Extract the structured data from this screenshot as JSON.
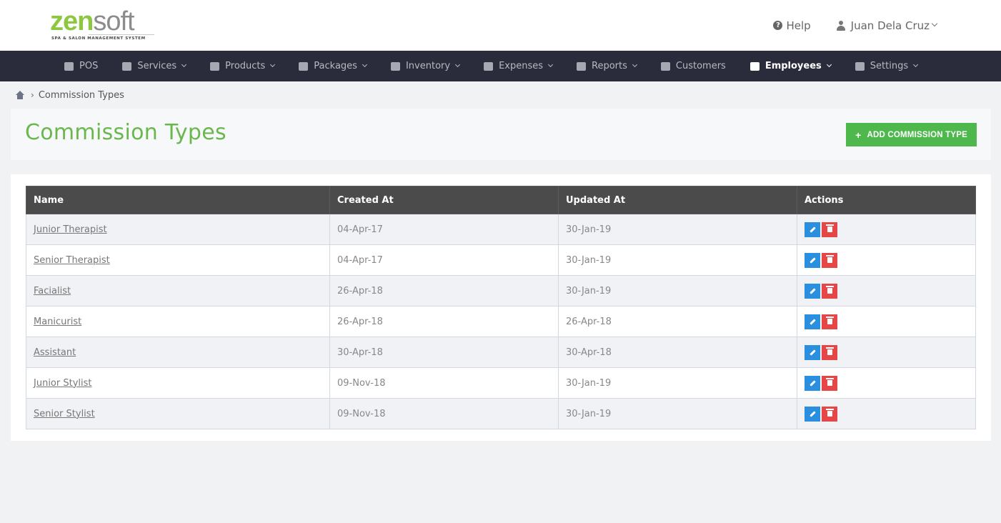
{
  "brand": {
    "zen": "zen",
    "soft": "soft",
    "tagline": "SPA & SALON MANAGEMENT SYSTEM"
  },
  "header": {
    "help_label": "Help",
    "user_name": "Juan Dela Cruz"
  },
  "nav": {
    "items": [
      {
        "label": "POS",
        "icon": "calculator-icon",
        "has_caret": false
      },
      {
        "label": "Services",
        "icon": "hand-icon",
        "has_caret": true
      },
      {
        "label": "Products",
        "icon": "cart-icon",
        "has_caret": true
      },
      {
        "label": "Packages",
        "icon": "tags-icon",
        "has_caret": true
      },
      {
        "label": "Inventory",
        "icon": "list-icon",
        "has_caret": true
      },
      {
        "label": "Expenses",
        "icon": "image-icon",
        "has_caret": true
      },
      {
        "label": "Reports",
        "icon": "bar-chart-icon",
        "has_caret": true
      },
      {
        "label": "Customers",
        "icon": "users-icon",
        "has_caret": false
      },
      {
        "label": "Employees",
        "icon": "briefcase-icon",
        "has_caret": true,
        "active": true
      },
      {
        "label": "Settings",
        "icon": "gear-icon",
        "has_caret": true
      }
    ]
  },
  "breadcrumb": {
    "current": "Commission Types"
  },
  "page": {
    "title": "Commission Types",
    "add_button": "ADD COMMISSION TYPE"
  },
  "table": {
    "columns": [
      "Name",
      "Created At",
      "Updated At",
      "Actions"
    ],
    "rows": [
      {
        "name": "Junior Therapist",
        "created": "04-Apr-17",
        "updated": "30-Jan-19"
      },
      {
        "name": "Senior Therapist",
        "created": "04-Apr-17",
        "updated": "30-Jan-19"
      },
      {
        "name": "Facialist",
        "created": "26-Apr-18",
        "updated": "30-Jan-19"
      },
      {
        "name": "Manicurist",
        "created": "26-Apr-18",
        "updated": "26-Apr-18"
      },
      {
        "name": "Assistant",
        "created": "30-Apr-18",
        "updated": "30-Apr-18"
      },
      {
        "name": "Junior Stylist",
        "created": "09-Nov-18",
        "updated": "30-Jan-19"
      },
      {
        "name": "Senior Stylist",
        "created": "09-Nov-18",
        "updated": "30-Jan-19"
      }
    ]
  },
  "colors": {
    "brand_green": "#8dc63f",
    "title_green": "#6ab74e",
    "add_button": "#4eb84d",
    "navbar": "#2a2c3b",
    "table_header": "#4b4b4b",
    "edit_button": "#2a8fde",
    "delete_button": "#e64646"
  }
}
